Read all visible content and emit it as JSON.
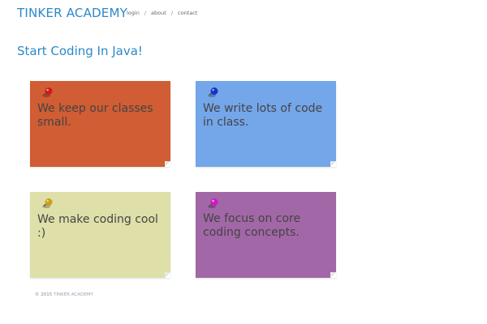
{
  "header": {
    "brand": "TINKER ACADEMY",
    "nav": [
      {
        "label": "login"
      },
      {
        "label": "about"
      },
      {
        "label": "contact"
      }
    ],
    "separator": "/"
  },
  "main": {
    "title": "Start Coding In Java!",
    "notes": [
      {
        "text": "We keep our classes small.",
        "color": "#d05d33",
        "pin_color": "#d11a1a",
        "pin": "red-pushpin-icon"
      },
      {
        "text": "We write lots of code in class.",
        "color": "#74a6ea",
        "pin_color": "#1434c8",
        "pin": "blue-pushpin-icon"
      },
      {
        "text": "We make coding cool :)",
        "color": "#dfdfa9",
        "pin_color": "#c9a016",
        "pin": "yellow-pushpin-icon"
      },
      {
        "text": "We focus on core coding concepts.",
        "color": "#a267a6",
        "pin_color": "#d018c2",
        "pin": "magenta-pushpin-icon"
      }
    ]
  },
  "footer": {
    "copyright": "© 2015",
    "brand": "TINKER ACADEMY"
  },
  "colors": {
    "accent": "#2e88c8",
    "note_text": "#444444"
  }
}
